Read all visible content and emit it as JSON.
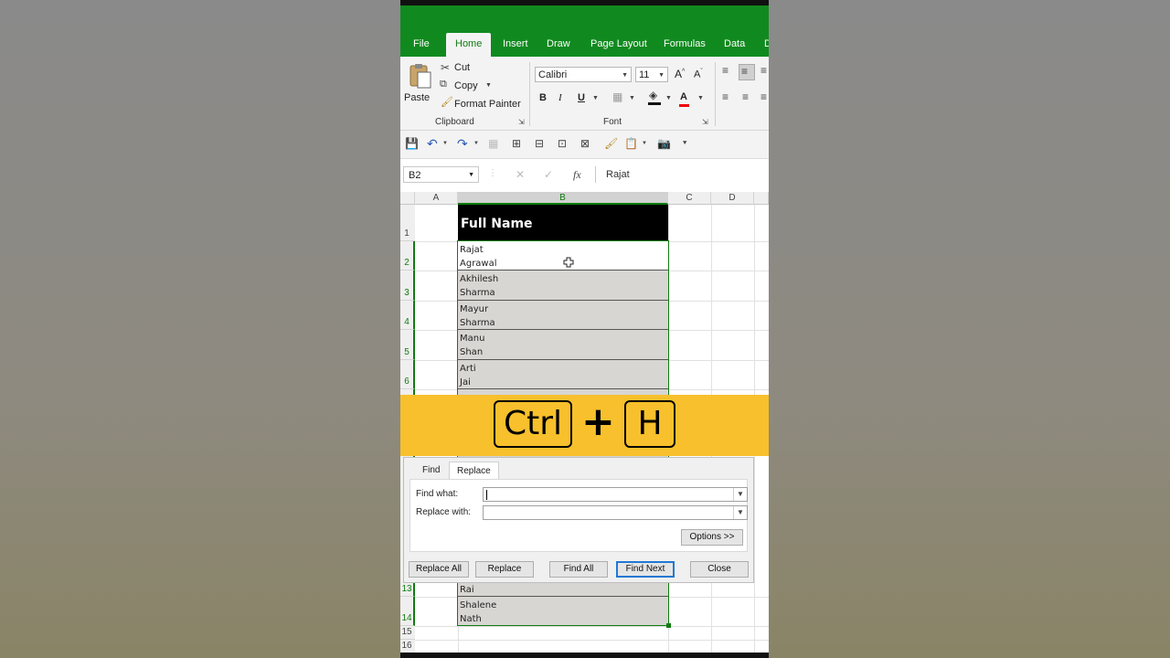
{
  "ribbon_tabs": [
    "File",
    "Home",
    "Insert",
    "Draw",
    "Page Layout",
    "Formulas",
    "Data",
    "D"
  ],
  "active_tab": "Home",
  "clipboard": {
    "paste": "Paste",
    "cut": "Cut",
    "copy": "Copy",
    "format_painter": "Format Painter",
    "group_label": "Clipboard"
  },
  "font": {
    "name": "Calibri",
    "size": "11",
    "bold": "B",
    "italic": "I",
    "underline": "U",
    "group_label": "Font"
  },
  "formula_bar": {
    "name_box": "B2",
    "fx": "fx",
    "value": "Rajat"
  },
  "sheet": {
    "columns": [
      "A",
      "B",
      "C",
      "D"
    ],
    "rows": [
      "1",
      "2",
      "3",
      "4",
      "5",
      "6",
      "13",
      "14",
      "15",
      "16"
    ],
    "header": "Full Name",
    "names": [
      [
        "Rajat",
        "Agrawal"
      ],
      [
        "Akhilesh",
        "Sharma"
      ],
      [
        "Mayur",
        "Sharma"
      ],
      [
        "Manu",
        "Shan"
      ],
      [
        "Arti",
        "Jai"
      ]
    ],
    "lower_names": [
      [
        "Rai"
      ],
      [
        "Shalene",
        "Nath"
      ]
    ]
  },
  "shortcut": {
    "key1": "Ctrl",
    "plus": "+",
    "key2": "H"
  },
  "dialog": {
    "tab_find": "Find",
    "tab_replace": "Replace",
    "find_what_label": "Find what:",
    "replace_with_label": "Replace with:",
    "find_what_value": "",
    "replace_with_value": "",
    "options_button": "Options >>",
    "replace_all": "Replace All",
    "replace": "Replace",
    "find_all": "Find All",
    "find_next": "Find Next",
    "close": "Close"
  },
  "colors": {
    "excel_green": "#108a1f",
    "banner_yellow": "#f7c02c",
    "selection_green": "#107c10"
  }
}
